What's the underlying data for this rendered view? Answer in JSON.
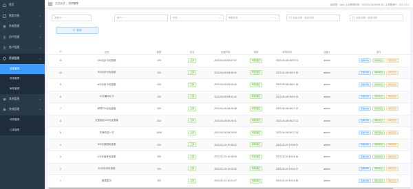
{
  "sidebar": {
    "items": [
      {
        "label": "首页",
        "icon": "home-icon"
      },
      {
        "label": "数据字典",
        "icon": "book-icon"
      },
      {
        "label": "系统管理",
        "icon": "gear-icon"
      },
      {
        "label": "用户管理",
        "icon": "user-icon"
      },
      {
        "label": "商户管理",
        "icon": "user-icon"
      },
      {
        "label": "资质管理",
        "icon": "shield-icon",
        "open": true
      }
    ],
    "subitems_a": [
      {
        "label": "资质管理",
        "active": true
      },
      {
        "label": "其他管理",
        "active": false
      },
      {
        "label": "审核管理",
        "active": false
      }
    ],
    "items2": [
      {
        "label": "其他管理",
        "icon": "gear-icon"
      },
      {
        "label": "系统管理",
        "icon": "gear-icon"
      }
    ],
    "subitems_b": [
      {
        "label": "体现管理"
      },
      {
        "label": "订单管理"
      }
    ]
  },
  "topbar": {
    "crumb1": "资质管理",
    "sep": "/",
    "crumb2": "资质管理",
    "welcome": "欢迎您：sad | 上次登录时间：2023-04-08 08:59:26 | 上次登录IP：127.0.0.1"
  },
  "filters": {
    "name_placeholder": "充值卡",
    "merchant_placeholder": "用户",
    "state_placeholder": "状态",
    "audit_placeholder": "审核状态",
    "date1_placeholder": "起始日期 - 结束日期",
    "date2_placeholder": "起始日期 - 结束日期",
    "search_label": "查询"
  },
  "table": {
    "headers": [
      "ID",
      "名称",
      "面额",
      "状态",
      "创建时间",
      "审核",
      "审核时间",
      "创建人",
      "操作"
    ],
    "rows": [
      {
        "id": "11",
        "name": "150元米卡优惠卷",
        "price": "100",
        "state": "上架",
        "created": "2023-04-08 08:57:02",
        "audit": "审核通过",
        "audit_time": "2023-04-08 08:57:21",
        "by": "admin"
      },
      {
        "id": "10",
        "name": "300元米卡优惠卷",
        "price": "100",
        "state": "上架",
        "created": "2023-04-08 08:55:34",
        "audit": "审核通过",
        "audit_time": "2023-04-08 08:57:19",
        "by": "admin"
      },
      {
        "id": "9",
        "name": "600元米卡优惠卷",
        "price": "100",
        "state": "上架",
        "created": "2023-04-08 08:53:46",
        "audit": "审核通过",
        "audit_time": "2023-04-08 08:57:16",
        "by": "admin"
      },
      {
        "id": "8",
        "name": "10元播牛礼卡",
        "price": "100",
        "state": "上架",
        "created": "2023-04-08 08:51:42",
        "audit": "审核通过",
        "audit_time": "2023-04-08 08:57:13",
        "by": "admin"
      },
      {
        "id": "7",
        "name": "种球100元优惠卷",
        "price": "100",
        "state": "上架",
        "created": "2023-04-08 08:26:38",
        "audit": "审核通过",
        "audit_time": "2023-04-08 08:27:12",
        "by": "admin"
      },
      {
        "id": "6",
        "name": "天堂朋友200元优惠卷",
        "price": "200",
        "state": "上架",
        "created": "2023-04-08 08:26:11",
        "audit": "审核通过",
        "audit_time": "2023-04-08 08:27:11",
        "by": "admin"
      },
      {
        "id": "5",
        "name": "先满先送一次",
        "price": "1000",
        "state": "上架",
        "created": "2023-04-08 08:19:50",
        "audit": "审核通过",
        "audit_time": "2023-04-08 08:27:10",
        "by": "admin"
      },
      {
        "id": "4",
        "name": "300元美团优惠卷",
        "price": "100",
        "state": "上架",
        "created": "2023-02-29 19:48:22",
        "audit": "审核通过",
        "audit_time": "2023-02-29 19:48:21",
        "by": "admin"
      },
      {
        "id": "3",
        "name": "100元保养优惠卷",
        "price": "100",
        "state": "上架",
        "created": "2023-02-29 19:45:00",
        "audit": "审核通过",
        "audit_time": "2023-02-29 19:45:24",
        "by": "admin"
      },
      {
        "id": "2",
        "name": "80元玩米优惠卷",
        "price": "100",
        "state": "上架",
        "created": "2023-02-29 19:43:32",
        "audit": "审核通过",
        "audit_time": "2023-02-29 19:44:27",
        "by": "admin"
      },
      {
        "id": "1",
        "name": "蒸蒸蒸16",
        "price": "100",
        "state": "上架",
        "created": "2023-02-29 15:21:27",
        "audit": "审核通过",
        "audit_time": "2023-02-29 19:43:35",
        "by": "admin"
      }
    ],
    "op_view": "查看详情",
    "op_pass": "审核通过",
    "op_reject": "审核驳回"
  }
}
